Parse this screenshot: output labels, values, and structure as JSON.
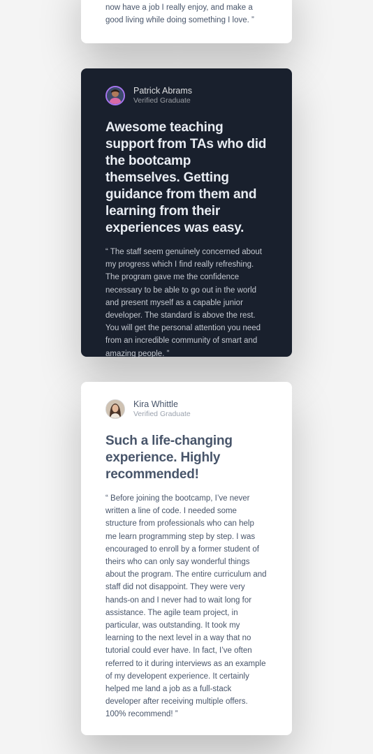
{
  "testimonials": [
    {
      "quote_end": "now have a job I really enjoy, and make a good living while doing something I love. ”"
    },
    {
      "name": "Patrick Abrams",
      "role": "Verified Graduate",
      "headline": "Awesome teaching support from TAs who did the bootcamp themselves. Getting guidance from them and learning from their experiences was easy.",
      "quote": "“ The staff seem genuinely concerned about my progress which I find really refreshing. The program gave me the confidence necessary to be able to go out in the world and present myself as a capable junior developer. The standard is above the rest. You will get the personal attention you need from an incredible community of smart and amazing people. ”"
    },
    {
      "name": "Kira Whittle",
      "role": "Verified Graduate",
      "headline": "Such a life-changing experience. Highly recommended!",
      "quote": "“ Before joining the bootcamp, I’ve never written a line of code. I needed some structure from professionals who can help me learn programming step by step. I was encouraged to enroll by a former student of theirs who can only say wonderful things about the program. The entire curriculum and staff did not disappoint. They were very hands-on and I never had to wait long for assistance. The agile team project, in particular, was outstanding. It took my learning to the next level in a way that no tutorial could ever have. In fact, I’ve often referred to it during interviews as an example of my developent experience. It certainly helped me land a job as a full-stack developer after receiving multiple offers. 100% recommend! ”"
    }
  ],
  "colors": {
    "dark_card": "#19202d",
    "light_card": "#ffffff",
    "accent_ring": "#a775f1",
    "text_grey": "#48556a"
  }
}
